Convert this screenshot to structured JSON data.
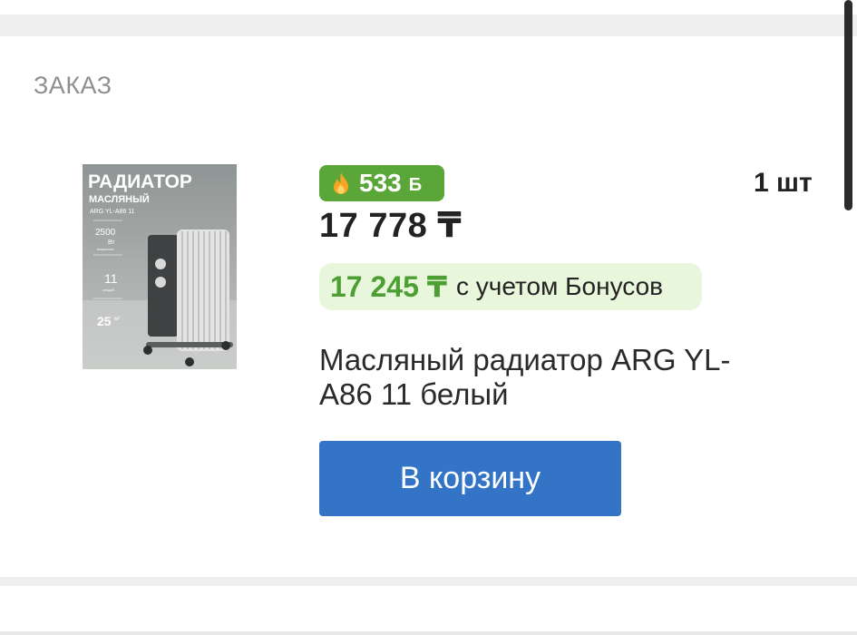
{
  "section": {
    "title": "ЗАКАЗ"
  },
  "product": {
    "image": {
      "title": "РАДИАТОР",
      "subtitle": "МАСЛЯНЫЙ",
      "model": "ARG YL-A86 11",
      "spec_power_value": "2500",
      "spec_power_unit": "Вт",
      "spec_power_note": "мощность",
      "spec_sections_value": "11",
      "spec_sections_note": "секций",
      "spec_area_value": "25",
      "spec_area_unit": "м²"
    },
    "bonus_badge": {
      "icon": "fire-icon",
      "amount": "533",
      "suffix": "Б"
    },
    "price": "17 778 ₸",
    "bonus_price": {
      "value": "17 245 ₸",
      "note": "с учетом Бонусов"
    },
    "name": "Масляный радиатор ARG YL-A86 11 белый",
    "quantity": "1 шт"
  },
  "actions": {
    "cart_button": "В корзину"
  },
  "colors": {
    "bonus_green": "#5aa638",
    "bonus_text_green": "#4e9f33",
    "bonus_bg": "#e8f6dc",
    "button_blue": "#3374c7",
    "muted_gray": "#8e8e8e"
  }
}
